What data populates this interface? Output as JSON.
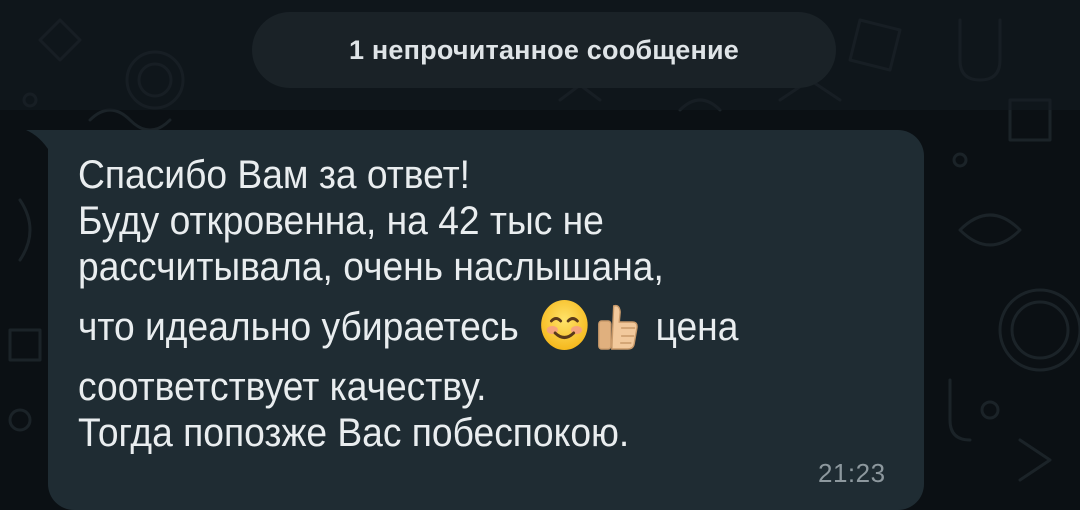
{
  "unread_banner": {
    "text": "1 непрочитанное сообщение"
  },
  "message": {
    "line1": "Спасибо Вам за ответ!",
    "line2": "Буду откровенна, на 42 тыс не",
    "line3": "рассчитывала, очень наслышана,",
    "line4_before": "что идеально убираетесь",
    "line4_after": " цена",
    "line5": "соответствует качеству.",
    "line6": "Тогда попозже Вас побеспокою.",
    "time": "21:23",
    "emojis": [
      "smiling-face-icon",
      "thumbs-up-icon"
    ]
  },
  "colors": {
    "background": "#0b1014",
    "bubble": "#1f2c33",
    "text": "#e9edef",
    "timestamp": "#8d989e",
    "unread_pill": "#1a2227"
  }
}
